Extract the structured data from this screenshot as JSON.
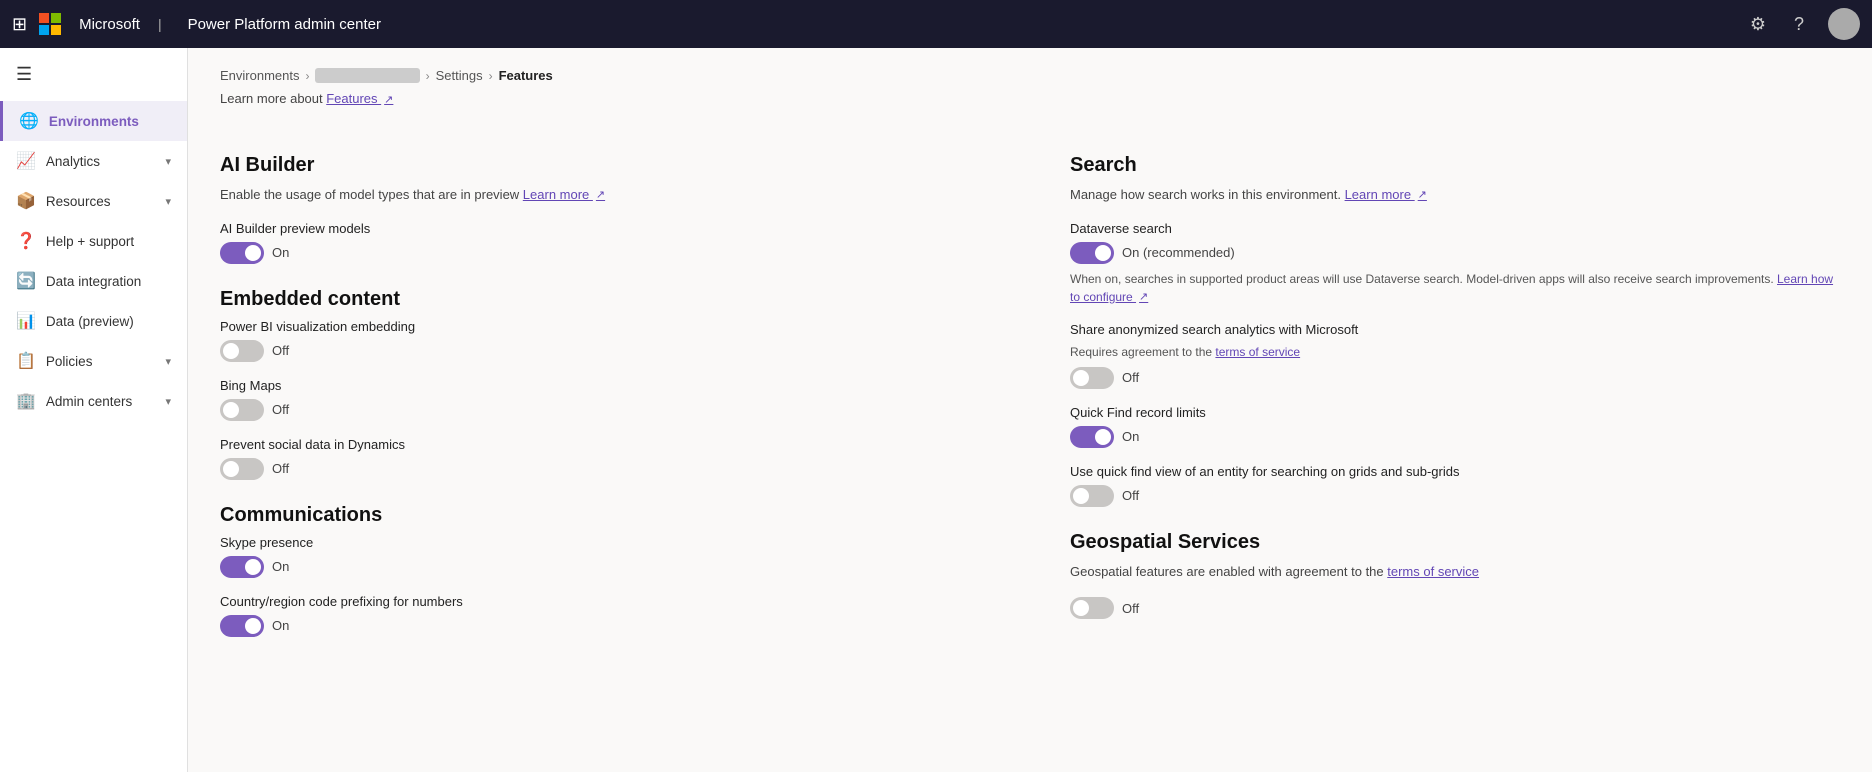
{
  "topbar": {
    "title": "Power Platform admin center",
    "waffle_icon": "⊞",
    "settings_icon": "⚙",
    "help_icon": "?"
  },
  "sidebar": {
    "items": [
      {
        "id": "environments",
        "label": "Environments",
        "icon": "🌐",
        "active": true,
        "has_chevron": false
      },
      {
        "id": "analytics",
        "label": "Analytics",
        "icon": "📈",
        "active": false,
        "has_chevron": true
      },
      {
        "id": "resources",
        "label": "Resources",
        "icon": "📦",
        "active": false,
        "has_chevron": true
      },
      {
        "id": "help-support",
        "label": "Help + support",
        "icon": "❓",
        "active": false,
        "has_chevron": false
      },
      {
        "id": "data-integration",
        "label": "Data integration",
        "icon": "🔄",
        "active": false,
        "has_chevron": false
      },
      {
        "id": "data-preview",
        "label": "Data (preview)",
        "icon": "📊",
        "active": false,
        "has_chevron": false
      },
      {
        "id": "policies",
        "label": "Policies",
        "icon": "📋",
        "active": false,
        "has_chevron": true
      },
      {
        "id": "admin-centers",
        "label": "Admin centers",
        "icon": "🏢",
        "active": false,
        "has_chevron": true
      }
    ]
  },
  "breadcrumb": {
    "environments": "Environments",
    "env_name": "██████████",
    "settings": "Settings",
    "current": "Features"
  },
  "learn_more": {
    "prefix": "Learn more about",
    "link": "Features",
    "icon": "↗"
  },
  "left_column": {
    "sections": [
      {
        "id": "ai-builder",
        "title": "AI Builder",
        "desc": "Enable the usage of model types that are in preview",
        "desc_link": "Learn more",
        "features": [
          {
            "id": "ai-builder-preview",
            "label": "AI Builder preview models",
            "state": "on",
            "state_text": "On"
          }
        ]
      },
      {
        "id": "embedded-content",
        "title": "Embedded content",
        "desc": "",
        "features": [
          {
            "id": "power-bi-embedding",
            "label": "Power BI visualization embedding",
            "state": "off",
            "state_text": "Off"
          },
          {
            "id": "bing-maps",
            "label": "Bing Maps",
            "state": "off",
            "state_text": "Off"
          },
          {
            "id": "prevent-social-data",
            "label": "Prevent social data in Dynamics",
            "state": "off",
            "state_text": "Off"
          }
        ]
      },
      {
        "id": "communications",
        "title": "Communications",
        "desc": "",
        "features": [
          {
            "id": "skype-presence",
            "label": "Skype presence",
            "state": "on",
            "state_text": "On"
          },
          {
            "id": "country-code-prefixing",
            "label": "Country/region code prefixing for numbers",
            "state": "on",
            "state_text": "On"
          }
        ]
      }
    ]
  },
  "right_column": {
    "sections": [
      {
        "id": "search",
        "title": "Search",
        "desc": "Manage how search works in this environment.",
        "desc_link": "Learn more",
        "features": [
          {
            "id": "dataverse-search",
            "label": "Dataverse search",
            "state": "on",
            "state_text": "On (recommended)",
            "note": "When on, searches in supported product areas will use Dataverse search. Model-driven apps will also receive search improvements.",
            "note_link": "Learn how to configure",
            "note_link_icon": "↗"
          },
          {
            "id": "share-search-analytics",
            "label": "Share anonymized search analytics with Microsoft",
            "sublabel": "Requires agreement to the",
            "sublabel_link": "terms of service",
            "state": "off",
            "state_text": "Off"
          },
          {
            "id": "quick-find-limits",
            "label": "Quick Find record limits",
            "state": "on",
            "state_text": "On"
          },
          {
            "id": "quick-find-view",
            "label": "Use quick find view of an entity for searching on grids and sub-grids",
            "state": "off",
            "state_text": "Off"
          }
        ]
      },
      {
        "id": "geospatial-services",
        "title": "Geospatial Services",
        "desc": "Geospatial features are enabled with agreement to the",
        "desc_link": "terms of service",
        "features": [
          {
            "id": "geospatial-toggle",
            "label": "",
            "state": "off",
            "state_text": "Off"
          }
        ]
      }
    ]
  }
}
